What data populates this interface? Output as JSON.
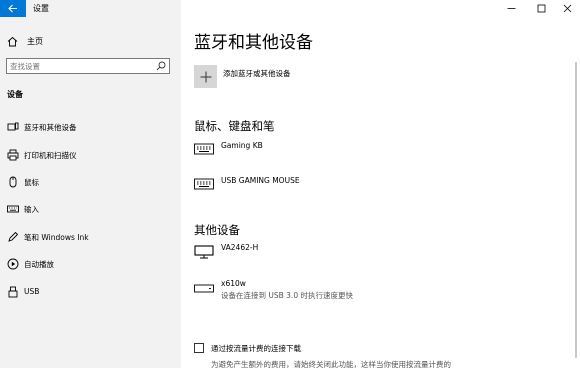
{
  "window": {
    "title": "设置",
    "controls": [
      "minimize-icon",
      "maximize-icon",
      "close-icon"
    ]
  },
  "sidebar": {
    "home_label": "主页",
    "search_placeholder": "查找设置",
    "section_header": "设备",
    "items": [
      {
        "label": "蓝牙和其他设备",
        "icon": "bluetooth-devices-icon"
      },
      {
        "label": "打印机和扫描仪",
        "icon": "printer-icon"
      },
      {
        "label": "鼠标",
        "icon": "mouse-icon"
      },
      {
        "label": "输入",
        "icon": "keyboard-icon"
      },
      {
        "label": "笔和 Windows Ink",
        "icon": "pen-icon"
      },
      {
        "label": "自动播放",
        "icon": "autoplay-icon"
      },
      {
        "label": "USB",
        "icon": "usb-icon"
      }
    ]
  },
  "main": {
    "title": "蓝牙和其他设备",
    "add_device_label": "添加蓝牙或其他设备",
    "groups": [
      {
        "header": "鼠标、键盘和笔",
        "devices": [
          {
            "name": "Gaming KB",
            "status": "",
            "icon": "keyboard-icon"
          },
          {
            "name": "USB GAMING MOUSE",
            "status": "",
            "icon": "keyboard-icon"
          }
        ]
      },
      {
        "header": "其他设备",
        "devices": [
          {
            "name": "VA2462-H",
            "status": "",
            "icon": "monitor-icon"
          },
          {
            "name": "x610w",
            "status": "设备在连接到 USB 3.0 时执行速度更快",
            "icon": "usb-drive-icon"
          }
        ]
      }
    ],
    "metered_checkbox_label": "通过按流量计费的连接下载",
    "metered_checkbox_checked": false,
    "metered_description": "为避免产生额外的费用，请始终关闭此功能，这样当你使用按流量计费的"
  },
  "colors": {
    "accent": "#0078d7",
    "sidebar_bg": "#f2f2f2",
    "tile_bg": "#d6d6d6"
  }
}
